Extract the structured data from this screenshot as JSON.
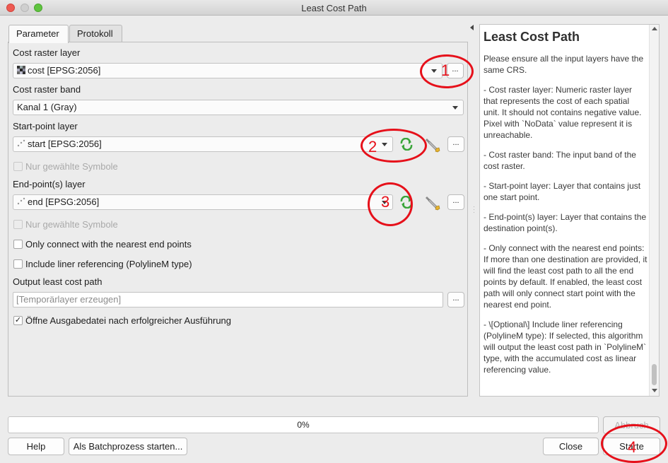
{
  "window": {
    "title": "Least Cost Path"
  },
  "tabs": [
    {
      "label": "Parameter",
      "active": true
    },
    {
      "label": "Protokoll",
      "active": false
    }
  ],
  "form": {
    "cost_raster_layer": {
      "label": "Cost raster layer",
      "value": "cost [EPSG:2056]",
      "browse_label": "..."
    },
    "cost_raster_band": {
      "label": "Cost raster band",
      "value": "Kanal 1 (Gray)"
    },
    "start_point_layer": {
      "label": "Start-point layer",
      "value": "start [EPSG:2056]",
      "selected_only_label": "Nur gewählte Symbole",
      "browse_label": "..."
    },
    "end_point_layer": {
      "label": "End-point(s) layer",
      "value": "end [EPSG:2056]",
      "selected_only_label": "Nur gewählte Symbole",
      "browse_label": "..."
    },
    "only_nearest": {
      "label": "Only connect with the nearest end points",
      "checked": false
    },
    "liner_referencing": {
      "label": "Include liner referencing (PolylineM type)",
      "checked": false
    },
    "output": {
      "label": "Output least cost path",
      "placeholder": "[Temporärlayer erzeugen]",
      "browse_label": "..."
    },
    "open_output": {
      "label": "Öffne Ausgabedatei nach erfolgreicher Ausführung",
      "checked": true,
      "check_mark": "✓"
    }
  },
  "help": {
    "title": "Least Cost Path",
    "paragraphs": [
      "Please ensure all the input layers have the same CRS.",
      "- Cost raster layer: Numeric raster layer that represents the cost of each spatial unit. It should not contains negative value. Pixel with `NoData` value represent it is unreachable.",
      "- Cost raster band: The input band of the cost raster.",
      "- Start-point layer: Layer that contains just one start point.",
      "- End-point(s) layer: Layer that contains the destination point(s).",
      "- Only connect with the nearest end points: If more than one destination are provided, it will find the least cost path to all the end points by default. If enabled, the least cost path will only connect start point with the nearest end point.",
      "- \\[Optional\\] Include liner referencing (PolylineM type): If selected, this algorithm will output the least cost path in `PolylineM` type, with the accumulated cost as linear referencing value."
    ]
  },
  "progress": {
    "value": 0,
    "label": "0%"
  },
  "buttons": {
    "abort": "Abbruch",
    "help": "Help",
    "batch": "Als Batchprozess starten...",
    "close": "Close",
    "start": "Starte"
  },
  "annotations": [
    "1",
    "2",
    "3",
    "4"
  ],
  "colors": {
    "annotation": "#e6101a",
    "refresh_icon": "#3aa53a"
  },
  "icons": {
    "raster_layer": "raster-layer-icon",
    "point_layer": "point-layer-icon",
    "refresh": "refresh-icon",
    "wrench": "wrench-icon"
  }
}
